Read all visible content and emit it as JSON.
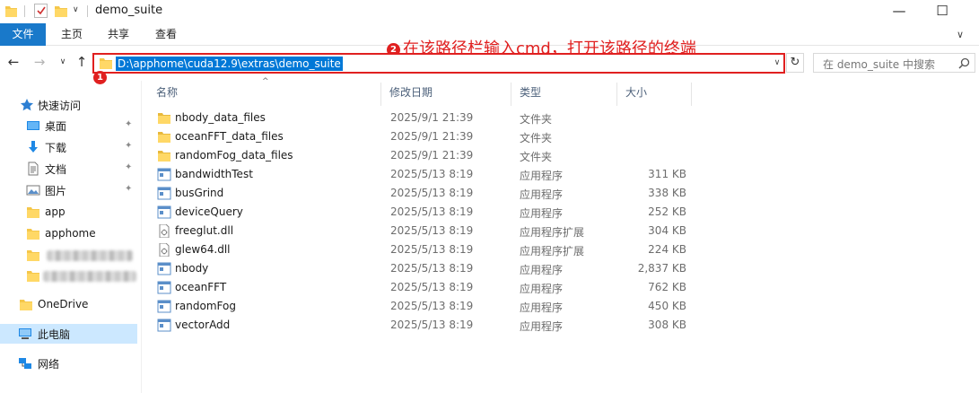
{
  "window": {
    "title": "demo_suite",
    "minimize_glyph": "—",
    "maximize_glyph": "☐"
  },
  "ribbon": {
    "tabs": [
      "文件",
      "主页",
      "共享",
      "查看"
    ],
    "collapse_glyph": "∨"
  },
  "navigation": {
    "back_glyph": "←",
    "forward_glyph": "→",
    "recent_glyph": "∨",
    "up_glyph": "↑",
    "address": "D:\\apphome\\cuda12.9\\extras\\demo_suite",
    "dropdown_glyph": "∨",
    "refresh_glyph": "↻",
    "search_placeholder": "在 demo_suite 中搜索"
  },
  "annotations": {
    "step1_number": "1",
    "step2_number": "2",
    "step2_text": "在该路径栏输入cmd，打开该路径的终端",
    "color": "#e02020"
  },
  "sidebar": {
    "quick_access": "快速访问",
    "pinned": [
      {
        "label": "桌面",
        "icon": "desktop-icon"
      },
      {
        "label": "下载",
        "icon": "download-icon"
      },
      {
        "label": "文档",
        "icon": "document-icon"
      },
      {
        "label": "图片",
        "icon": "pictures-icon"
      }
    ],
    "pin_glyph": "✦",
    "folders": [
      "app",
      "apphome"
    ],
    "onedrive": "OneDrive",
    "this_pc": "此电脑",
    "network": "网络"
  },
  "file_list": {
    "columns": [
      "名称",
      "修改日期",
      "类型",
      "大小"
    ],
    "sort_glyph": "^",
    "rows": [
      {
        "name": "nbody_data_files",
        "date": "2025/9/1 21:39",
        "type": "文件夹",
        "size": "",
        "icon": "folder-icon"
      },
      {
        "name": "oceanFFT_data_files",
        "date": "2025/9/1 21:39",
        "type": "文件夹",
        "size": "",
        "icon": "folder-icon"
      },
      {
        "name": "randomFog_data_files",
        "date": "2025/9/1 21:39",
        "type": "文件夹",
        "size": "",
        "icon": "folder-icon"
      },
      {
        "name": "bandwidthTest",
        "date": "2025/5/13 8:19",
        "type": "应用程序",
        "size": "311 KB",
        "icon": "application-icon"
      },
      {
        "name": "busGrind",
        "date": "2025/5/13 8:19",
        "type": "应用程序",
        "size": "338 KB",
        "icon": "application-icon"
      },
      {
        "name": "deviceQuery",
        "date": "2025/5/13 8:19",
        "type": "应用程序",
        "size": "252 KB",
        "icon": "application-icon"
      },
      {
        "name": "freeglut.dll",
        "date": "2025/5/13 8:19",
        "type": "应用程序扩展",
        "size": "304 KB",
        "icon": "dll-icon"
      },
      {
        "name": "glew64.dll",
        "date": "2025/5/13 8:19",
        "type": "应用程序扩展",
        "size": "224 KB",
        "icon": "dll-icon"
      },
      {
        "name": "nbody",
        "date": "2025/5/13 8:19",
        "type": "应用程序",
        "size": "2,837 KB",
        "icon": "application-icon"
      },
      {
        "name": "oceanFFT",
        "date": "2025/5/13 8:19",
        "type": "应用程序",
        "size": "762 KB",
        "icon": "application-icon"
      },
      {
        "name": "randomFog",
        "date": "2025/5/13 8:19",
        "type": "应用程序",
        "size": "450 KB",
        "icon": "application-icon"
      },
      {
        "name": "vectorAdd",
        "date": "2025/5/13 8:19",
        "type": "应用程序",
        "size": "308 KB",
        "icon": "application-icon"
      }
    ]
  }
}
